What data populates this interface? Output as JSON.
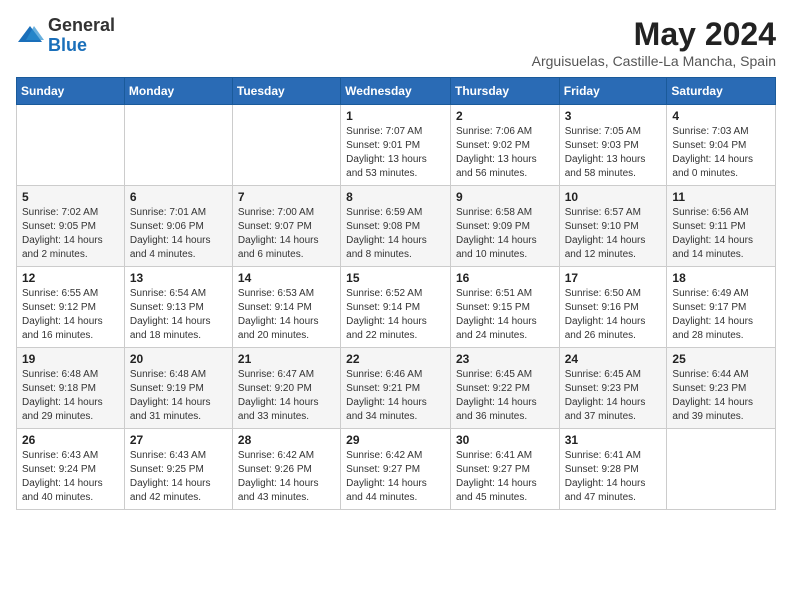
{
  "logo": {
    "general": "General",
    "blue": "Blue"
  },
  "title": {
    "month": "May 2024",
    "location": "Arguisuelas, Castille-La Mancha, Spain"
  },
  "weekdays": [
    "Sunday",
    "Monday",
    "Tuesday",
    "Wednesday",
    "Thursday",
    "Friday",
    "Saturday"
  ],
  "weeks": [
    [
      {
        "day": "",
        "info": ""
      },
      {
        "day": "",
        "info": ""
      },
      {
        "day": "",
        "info": ""
      },
      {
        "day": "1",
        "sunrise": "Sunrise: 7:07 AM",
        "sunset": "Sunset: 9:01 PM",
        "daylight": "Daylight: 13 hours and 53 minutes."
      },
      {
        "day": "2",
        "sunrise": "Sunrise: 7:06 AM",
        "sunset": "Sunset: 9:02 PM",
        "daylight": "Daylight: 13 hours and 56 minutes."
      },
      {
        "day": "3",
        "sunrise": "Sunrise: 7:05 AM",
        "sunset": "Sunset: 9:03 PM",
        "daylight": "Daylight: 13 hours and 58 minutes."
      },
      {
        "day": "4",
        "sunrise": "Sunrise: 7:03 AM",
        "sunset": "Sunset: 9:04 PM",
        "daylight": "Daylight: 14 hours and 0 minutes."
      }
    ],
    [
      {
        "day": "5",
        "sunrise": "Sunrise: 7:02 AM",
        "sunset": "Sunset: 9:05 PM",
        "daylight": "Daylight: 14 hours and 2 minutes."
      },
      {
        "day": "6",
        "sunrise": "Sunrise: 7:01 AM",
        "sunset": "Sunset: 9:06 PM",
        "daylight": "Daylight: 14 hours and 4 minutes."
      },
      {
        "day": "7",
        "sunrise": "Sunrise: 7:00 AM",
        "sunset": "Sunset: 9:07 PM",
        "daylight": "Daylight: 14 hours and 6 minutes."
      },
      {
        "day": "8",
        "sunrise": "Sunrise: 6:59 AM",
        "sunset": "Sunset: 9:08 PM",
        "daylight": "Daylight: 14 hours and 8 minutes."
      },
      {
        "day": "9",
        "sunrise": "Sunrise: 6:58 AM",
        "sunset": "Sunset: 9:09 PM",
        "daylight": "Daylight: 14 hours and 10 minutes."
      },
      {
        "day": "10",
        "sunrise": "Sunrise: 6:57 AM",
        "sunset": "Sunset: 9:10 PM",
        "daylight": "Daylight: 14 hours and 12 minutes."
      },
      {
        "day": "11",
        "sunrise": "Sunrise: 6:56 AM",
        "sunset": "Sunset: 9:11 PM",
        "daylight": "Daylight: 14 hours and 14 minutes."
      }
    ],
    [
      {
        "day": "12",
        "sunrise": "Sunrise: 6:55 AM",
        "sunset": "Sunset: 9:12 PM",
        "daylight": "Daylight: 14 hours and 16 minutes."
      },
      {
        "day": "13",
        "sunrise": "Sunrise: 6:54 AM",
        "sunset": "Sunset: 9:13 PM",
        "daylight": "Daylight: 14 hours and 18 minutes."
      },
      {
        "day": "14",
        "sunrise": "Sunrise: 6:53 AM",
        "sunset": "Sunset: 9:14 PM",
        "daylight": "Daylight: 14 hours and 20 minutes."
      },
      {
        "day": "15",
        "sunrise": "Sunrise: 6:52 AM",
        "sunset": "Sunset: 9:14 PM",
        "daylight": "Daylight: 14 hours and 22 minutes."
      },
      {
        "day": "16",
        "sunrise": "Sunrise: 6:51 AM",
        "sunset": "Sunset: 9:15 PM",
        "daylight": "Daylight: 14 hours and 24 minutes."
      },
      {
        "day": "17",
        "sunrise": "Sunrise: 6:50 AM",
        "sunset": "Sunset: 9:16 PM",
        "daylight": "Daylight: 14 hours and 26 minutes."
      },
      {
        "day": "18",
        "sunrise": "Sunrise: 6:49 AM",
        "sunset": "Sunset: 9:17 PM",
        "daylight": "Daylight: 14 hours and 28 minutes."
      }
    ],
    [
      {
        "day": "19",
        "sunrise": "Sunrise: 6:48 AM",
        "sunset": "Sunset: 9:18 PM",
        "daylight": "Daylight: 14 hours and 29 minutes."
      },
      {
        "day": "20",
        "sunrise": "Sunrise: 6:48 AM",
        "sunset": "Sunset: 9:19 PM",
        "daylight": "Daylight: 14 hours and 31 minutes."
      },
      {
        "day": "21",
        "sunrise": "Sunrise: 6:47 AM",
        "sunset": "Sunset: 9:20 PM",
        "daylight": "Daylight: 14 hours and 33 minutes."
      },
      {
        "day": "22",
        "sunrise": "Sunrise: 6:46 AM",
        "sunset": "Sunset: 9:21 PM",
        "daylight": "Daylight: 14 hours and 34 minutes."
      },
      {
        "day": "23",
        "sunrise": "Sunrise: 6:45 AM",
        "sunset": "Sunset: 9:22 PM",
        "daylight": "Daylight: 14 hours and 36 minutes."
      },
      {
        "day": "24",
        "sunrise": "Sunrise: 6:45 AM",
        "sunset": "Sunset: 9:23 PM",
        "daylight": "Daylight: 14 hours and 37 minutes."
      },
      {
        "day": "25",
        "sunrise": "Sunrise: 6:44 AM",
        "sunset": "Sunset: 9:23 PM",
        "daylight": "Daylight: 14 hours and 39 minutes."
      }
    ],
    [
      {
        "day": "26",
        "sunrise": "Sunrise: 6:43 AM",
        "sunset": "Sunset: 9:24 PM",
        "daylight": "Daylight: 14 hours and 40 minutes."
      },
      {
        "day": "27",
        "sunrise": "Sunrise: 6:43 AM",
        "sunset": "Sunset: 9:25 PM",
        "daylight": "Daylight: 14 hours and 42 minutes."
      },
      {
        "day": "28",
        "sunrise": "Sunrise: 6:42 AM",
        "sunset": "Sunset: 9:26 PM",
        "daylight": "Daylight: 14 hours and 43 minutes."
      },
      {
        "day": "29",
        "sunrise": "Sunrise: 6:42 AM",
        "sunset": "Sunset: 9:27 PM",
        "daylight": "Daylight: 14 hours and 44 minutes."
      },
      {
        "day": "30",
        "sunrise": "Sunrise: 6:41 AM",
        "sunset": "Sunset: 9:27 PM",
        "daylight": "Daylight: 14 hours and 45 minutes."
      },
      {
        "day": "31",
        "sunrise": "Sunrise: 6:41 AM",
        "sunset": "Sunset: 9:28 PM",
        "daylight": "Daylight: 14 hours and 47 minutes."
      },
      {
        "day": "",
        "info": ""
      }
    ]
  ]
}
